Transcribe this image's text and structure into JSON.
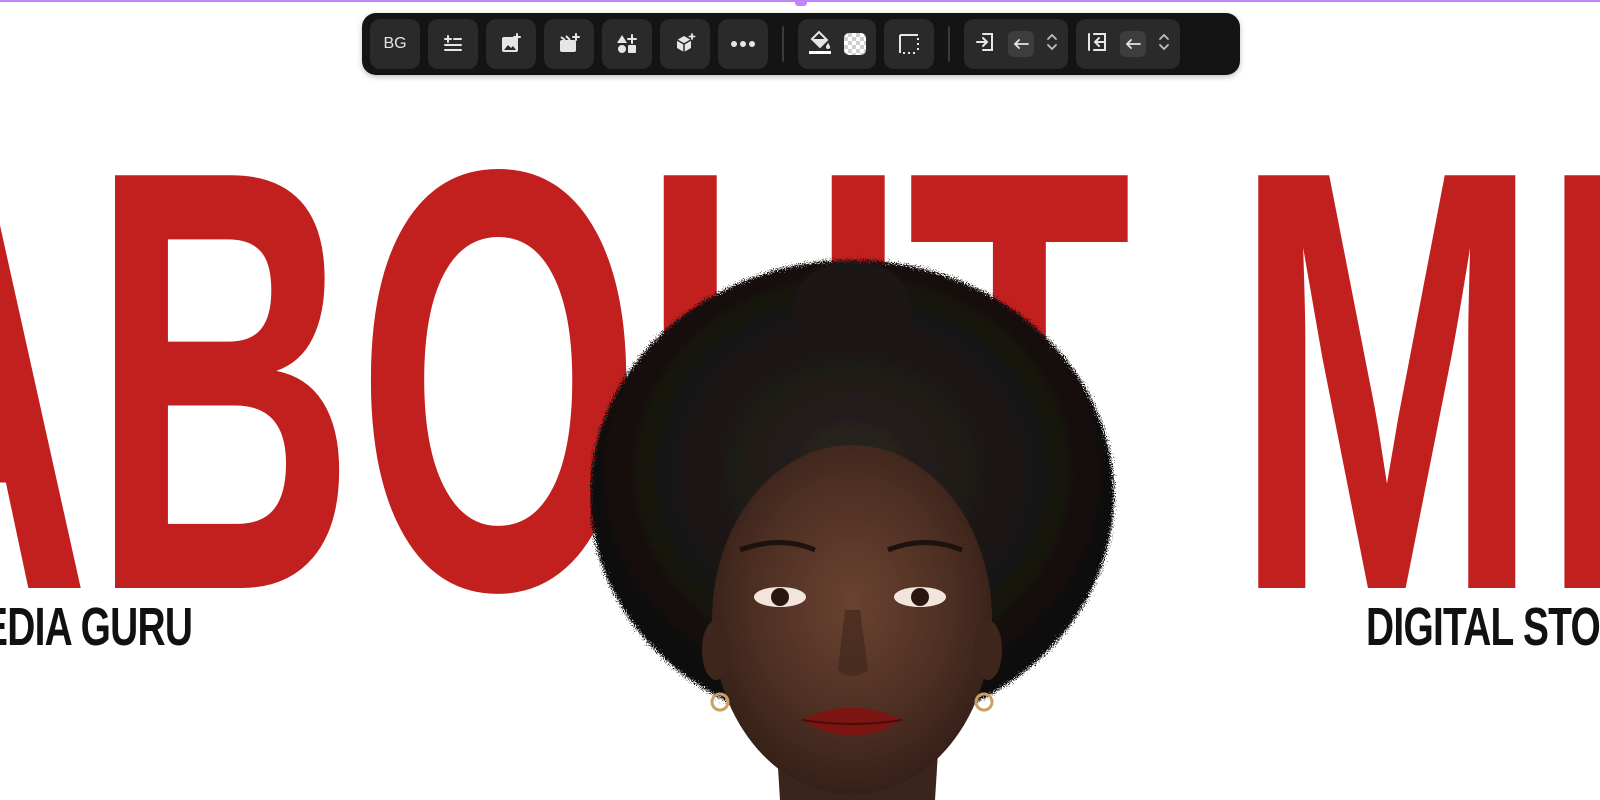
{
  "headline": {
    "text": "ABOUT ME",
    "color": "#c21f1f"
  },
  "captions": {
    "left": "EDIA GURU",
    "right": "DIGITAL STORY"
  },
  "toolbar": {
    "bg_label": "BG",
    "icons": {
      "text_align": "text-align-icon",
      "add_image": "add-image-icon",
      "add_video": "add-video-icon",
      "add_shapes": "add-shapes-icon",
      "add_3d": "add-3d-object-icon",
      "more": "more-icon",
      "fill": "paint-bucket-icon",
      "transparency": "transparency-swatch-icon",
      "border": "border-icon",
      "padding_left": "padding-left-icon",
      "arrow_left": "arrow-left-icon",
      "stepper": "chevron-up-down-icon",
      "margin_left": "margin-left-icon"
    },
    "fill_underline_color": "#ffffff"
  },
  "accent": "#c084fc",
  "portrait": {
    "icon": "portrait-photo"
  }
}
